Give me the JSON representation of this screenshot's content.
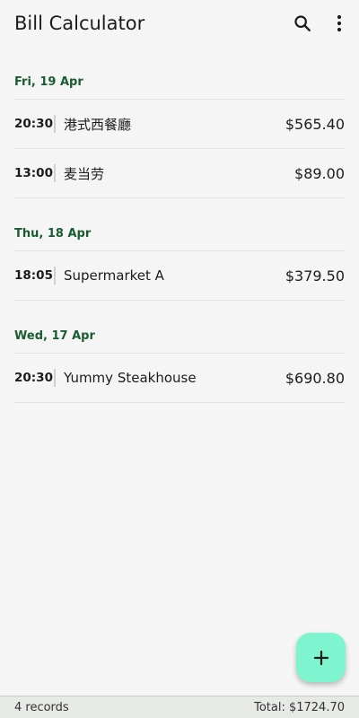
{
  "app": {
    "title": "Bill Calculator"
  },
  "icons": {
    "search": "search-icon",
    "more": "more-vert-icon",
    "add": "add-icon"
  },
  "days": [
    {
      "date": "Fri, 19 Apr",
      "bills": [
        {
          "time": "20:30",
          "name": "港式西餐廳",
          "amount": "$565.40"
        },
        {
          "time": "13:00",
          "name": "麦当劳",
          "amount": "$89.00"
        }
      ]
    },
    {
      "date": "Thu, 18 Apr",
      "bills": [
        {
          "time": "18:05",
          "name": "Supermarket A",
          "amount": "$379.50"
        }
      ]
    },
    {
      "date": "Wed, 17 Apr",
      "bills": [
        {
          "time": "20:30",
          "name": "Yummy Steakhouse",
          "amount": "$690.80"
        }
      ]
    }
  ],
  "footer": {
    "records": "4 records",
    "total": "Total: $1724.70"
  },
  "colors": {
    "accent": "#1a5c32",
    "fab": "#7ff5cf",
    "background": "#f5f5f5"
  }
}
